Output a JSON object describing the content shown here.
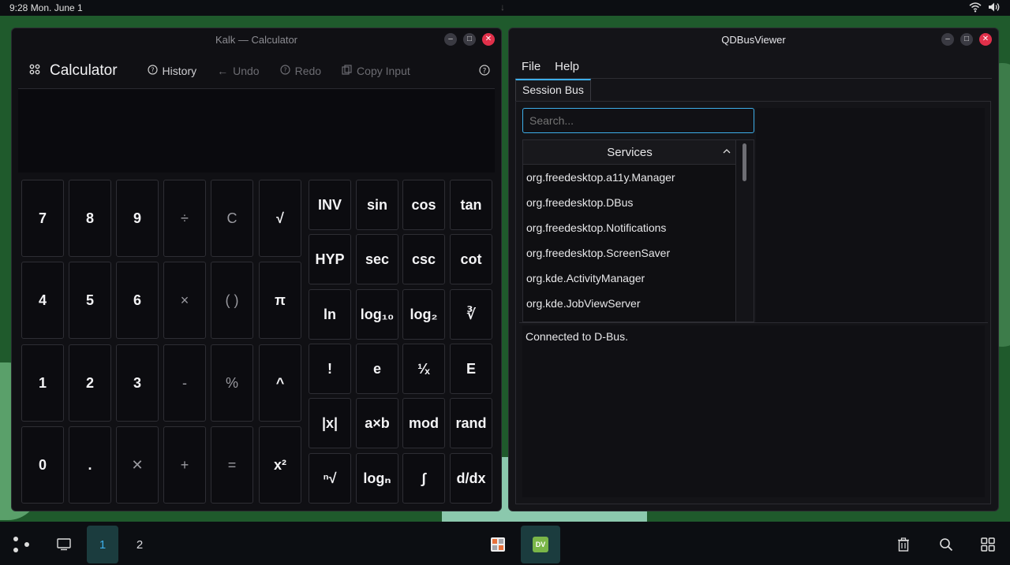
{
  "topbar": {
    "clock": "9:28  Mon. June 1",
    "icons": [
      "wifi-icon",
      "volume-icon"
    ]
  },
  "kalk": {
    "window_title": "Kalk — Calculator",
    "toolbar": {
      "title": "Calculator",
      "history": "History",
      "undo": "Undo",
      "redo": "Redo",
      "copy_input": "Copy Input"
    },
    "display": "",
    "basic_keys": [
      [
        "7",
        "8",
        "9",
        "÷",
        "C",
        "√"
      ],
      [
        "4",
        "5",
        "6",
        "×",
        "( )",
        "π"
      ],
      [
        "1",
        "2",
        "3",
        "-",
        "%",
        "^"
      ],
      [
        "0",
        ".",
        "✕",
        "+",
        "=",
        "x²"
      ]
    ],
    "function_keys": [
      [
        "INV",
        "sin",
        "cos",
        "tan"
      ],
      [
        "HYP",
        "sec",
        "csc",
        "cot"
      ],
      [
        "ln",
        "log₁₀",
        "log₂",
        "∛"
      ],
      [
        "!",
        "e",
        "¹⁄ₓ",
        "E"
      ],
      [
        "|x|",
        "a×b",
        "mod",
        "rand"
      ],
      [
        "ⁿ√",
        "logₙ",
        "∫",
        "d/dx"
      ]
    ]
  },
  "qdbus": {
    "window_title": "QDBusViewer",
    "menu": [
      "File",
      "Help"
    ],
    "tab": "Session Bus",
    "search_placeholder": "Search...",
    "services_header": "Services",
    "services": [
      "org.freedesktop.a11y.Manager",
      "org.freedesktop.DBus",
      "org.freedesktop.Notifications",
      "org.freedesktop.ScreenSaver",
      "org.kde.ActivityManager",
      "org.kde.JobViewServer"
    ],
    "log": "Connected to D-Bus."
  },
  "taskbar": {
    "desktops": [
      "1",
      "2"
    ],
    "active_desktop": "1",
    "dv_label": "DV"
  },
  "colors": {
    "accent": "#3daee9",
    "close": "#e0304a",
    "wallpaper": "#1f5a2c"
  }
}
